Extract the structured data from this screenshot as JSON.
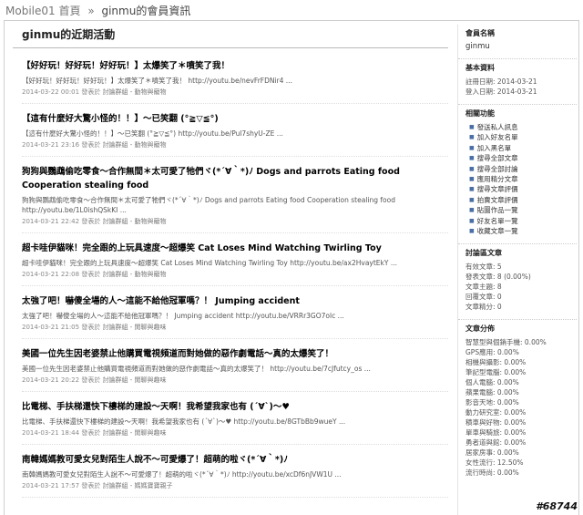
{
  "breadcrumb": {
    "site": "Mobile01",
    "home": "首頁",
    "separator": "»",
    "current": "ginmu的會員資訊"
  },
  "main": {
    "title": "ginmu的近期活動",
    "posts": [
      {
        "title": "【好好玩！好好玩！好好玩！】太爆笑了＊噴笑了我！",
        "excerpt": "【好好玩！好好玩！好好玩！】太爆笑了＊噴笑了我！ http://youtu.be/nevFrFDNir4 ...",
        "date": "2014-03-22 00:01",
        "action": "發表於",
        "category": "討論群組 - 動物與寵物"
      },
      {
        "title": "【這有什麼好大驚小怪的！！】～已笑翻 (°≧▽≦°)",
        "excerpt": "【這有什麼好大驚小怪的！！】～已笑翻 (°≧▽≦°) http://youtu.be/Pul7shyU-ZE ...",
        "date": "2014-03-21 23:16",
        "action": "發表於",
        "category": "討論群組 - 動物與寵物"
      },
      {
        "title": "狗狗與鸚鵡偷吃零食～合作無間＊太可愛了牠們ヾ(*´∀｀*)ﾉ Dogs and parrots Eating food Cooperation stealing food",
        "excerpt": "狗狗與鸚鵡偷吃零食～合作無間＊太可愛了牠們ヾ(*´∀｀*)ﾉ Dogs and parrots Eating food Cooperation stealing food http://youtu.be/1L0ishQSkKI ...",
        "date": "2014-03-21 22:42",
        "action": "發表於",
        "category": "討論群組 - 動物與寵物"
      },
      {
        "title": "超卡哇伊貓咪！完全跟的上玩具速度～超爆笑 Cat Loses Mind Watching Twirling Toy",
        "excerpt": "超卡哇伊貓咪！完全跟的上玩具速度～超爆笑 Cat Loses Mind Watching Twirling Toy http://youtu.be/ax2HvaytEkY ...",
        "date": "2014-03-21 22:08",
        "action": "發表於",
        "category": "討論群組 - 動物與寵物"
      },
      {
        "title": "太強了吧！嚇傻全場的人～這能不給他冠軍嗎？！ Jumping accident",
        "excerpt": "太強了吧！嚇傻全場的人～這能不給他冠軍嗎？！ Jumping accident http://youtu.be/VRRr3GO7olc ...",
        "date": "2014-03-21 21:05",
        "action": "發表於",
        "category": "討論群組 - 閒聊與趣味"
      },
      {
        "title": "美國一位先生因老婆禁止他購買電視頻道而對她做的惡作劇電話～真的太爆笑了！",
        "excerpt": "美國一位先生因老婆禁止他購買電視頻道而對她做的惡作劇電話～真的太爆笑了！ http://youtu.be/7cJfutcy_os ...",
        "date": "2014-03-21 20:22",
        "action": "發表於",
        "category": "討論群組 - 閒聊與趣味"
      },
      {
        "title": "比電梯、手扶梯還快下樓梯的建設～天啊！我希望我家也有 (´∀`)～♥",
        "excerpt": "比電梯、手扶梯還快下樓梯的建設～天啊！我希望我家也有 (´∀`)～♥ http://youtu.be/8GTbBb9wueY ...",
        "date": "2014-03-21 18:44",
        "action": "發表於",
        "category": "討論群組 - 閒聊與趣味"
      },
      {
        "title": "南韓媽媽教可愛女兒對陌生人說不～可愛爆了！超萌的啦ヾ(*´∀｀*)ﾉ",
        "excerpt": "南韓媽媽教可愛女兒對陌生人說不～可愛爆了！超萌的啦ヾ(*´∀｀*)ﾉ http://youtu.be/xcDf6nJVW1U ...",
        "date": "2014-03-21 17:57",
        "action": "發表於",
        "category": "討論群組 - 媽媽寶寶親子"
      }
    ]
  },
  "sidebar": {
    "member_name_heading": "會員名稱",
    "member_name": "ginmu",
    "basic_heading": "基本資料",
    "register_date": "註冊日期: 2014-03-21",
    "login_date": "登入日期: 2014-03-21",
    "functions_heading": "相關功能",
    "functions": [
      "發送私人訊息",
      "加入好友名單",
      "加入黑名單",
      "搜尋全部文章",
      "搜尋全部討論",
      "應用精分文章",
      "搜尋文章評價",
      "拍賣文章評價",
      "貼圖作品一覽",
      "好友名單一覽",
      "收藏文章一覽"
    ],
    "forum_heading": "討論區文章",
    "forum_stats": [
      "有效文章: 5",
      "發表文章: 8 (0.00%)",
      "文章主題: 8",
      "回覆文章: 0",
      "文章精分: 0"
    ],
    "dist_heading": "文章分佈",
    "distribution": [
      "智慧型與個銷手機: 0.00%",
      "GPS應用: 0.00%",
      "相機與攝影: 0.00%",
      "筆記型電腦: 0.00%",
      "個人電腦: 0.00%",
      "蘋果電腦: 0.00%",
      "影音天地: 0.00%",
      "動力研究室: 0.00%",
      "積車與好物: 0.00%",
      "單車與騎旅: 0.00%",
      "勇者道與館: 0.00%",
      "居家房事: 0.00%",
      "女性流行: 12.50%",
      "流行時尚: 0.00%"
    ]
  },
  "watermark": "#68744"
}
